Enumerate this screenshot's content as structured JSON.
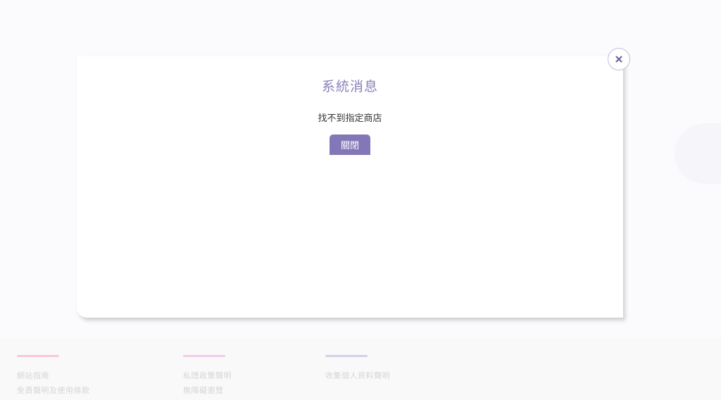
{
  "dialog": {
    "title": "系統消息",
    "message": "找不到指定商店",
    "close_button_label": "關閉"
  },
  "footer": {
    "columns": [
      {
        "line_color": "#f7b6c6",
        "links": [
          "網站指南",
          "免責聲明及使用條款"
        ]
      },
      {
        "line_color": "#f2b8e0",
        "links": [
          "私隱政策聲明",
          "無障礙瀏覽"
        ]
      },
      {
        "line_color": "#c6c0de",
        "links": [
          "收集個人資料聲明"
        ]
      }
    ]
  },
  "icons": {
    "close": "close-icon"
  },
  "colors": {
    "accent": "#8377b8",
    "title": "#8a80b8"
  }
}
